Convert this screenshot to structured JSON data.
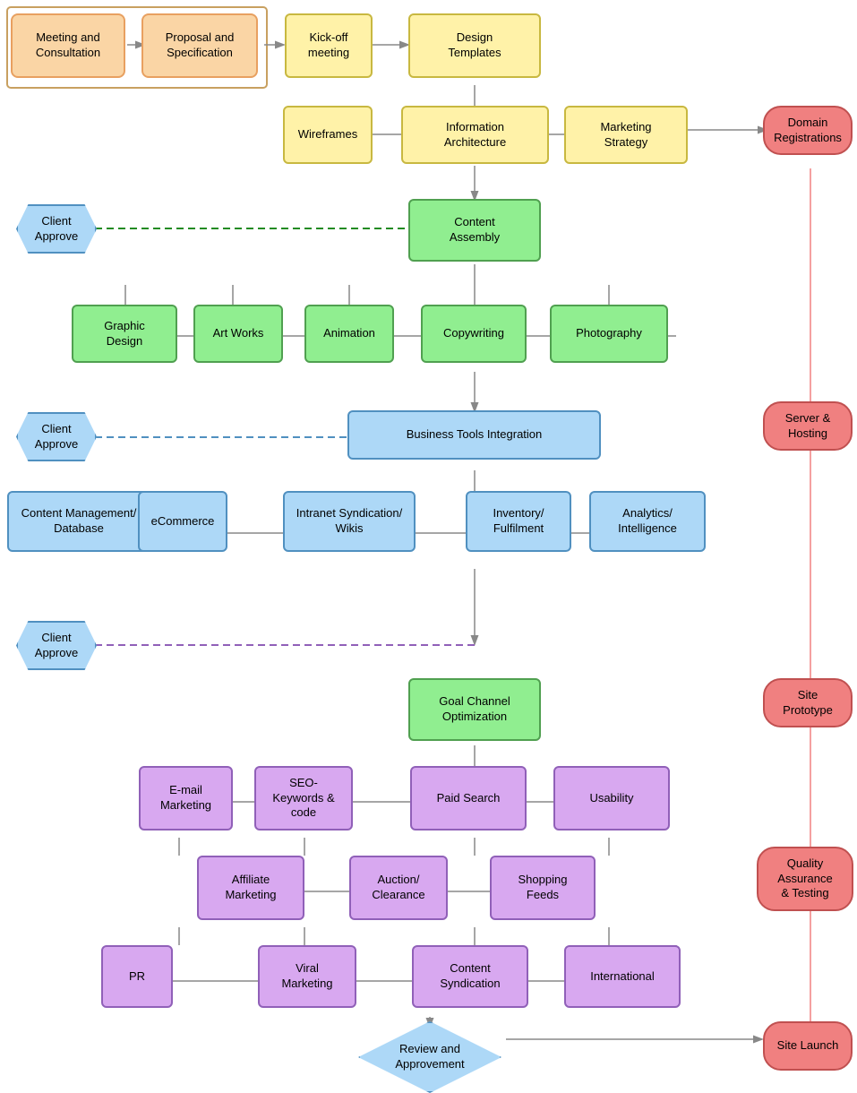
{
  "boxes": {
    "meeting": {
      "label": "Meeting and\nConsultation"
    },
    "proposal": {
      "label": "Proposal and\nSpecification"
    },
    "kickoff": {
      "label": "Kick-off\nmeeting"
    },
    "designTemplates": {
      "label": "Design\nTemplates"
    },
    "wireframes": {
      "label": "Wireframes"
    },
    "infoArch": {
      "label": "Information\nArchitecture"
    },
    "marketingStrategy": {
      "label": "Marketing\nStrategy"
    },
    "domainReg": {
      "label": "Domain\nRegistrations"
    },
    "contentAssembly": {
      "label": "Content\nAssembly"
    },
    "graphicDesign": {
      "label": "Graphic\nDesign"
    },
    "artWorks": {
      "label": "Art Works"
    },
    "animation": {
      "label": "Animation"
    },
    "copywriting": {
      "label": "Copywriting"
    },
    "photography": {
      "label": "Photography"
    },
    "clientApprove1": {
      "label": "Client\nApprove"
    },
    "clientApprove2": {
      "label": "Client\nApprove"
    },
    "clientApprove3": {
      "label": "Client\nApprove"
    },
    "bizTools": {
      "label": "Business Tools Integration"
    },
    "contentMgmt": {
      "label": "Content Management/\nDatabase"
    },
    "ecommerce": {
      "label": "eCommerce"
    },
    "intranet": {
      "label": "Intranet Syndication/\nWikis"
    },
    "inventory": {
      "label": "Inventory/\nFulfilment"
    },
    "analytics": {
      "label": "Analytics/\nIntelligence"
    },
    "serverHosting": {
      "label": "Server & Hosting"
    },
    "goalChannel": {
      "label": "Goal Channel\nOptimization"
    },
    "sitePrototype": {
      "label": "Site Prototype"
    },
    "emailMarketing": {
      "label": "E-mail\nMarketing"
    },
    "seoKeywords": {
      "label": "SEO-\nKeywords &\ncode"
    },
    "paidSearch": {
      "label": "Paid Search"
    },
    "usability": {
      "label": "Usability"
    },
    "affiliateMarketing": {
      "label": "Affiliate\nMarketing"
    },
    "auctionClearance": {
      "label": "Auction/\nClearance"
    },
    "shoppingFeeds": {
      "label": "Shopping\nFeeds"
    },
    "pr": {
      "label": "PR"
    },
    "viralMarketing": {
      "label": "Viral\nMarketing"
    },
    "contentSyndication": {
      "label": "Content\nSyndication"
    },
    "international": {
      "label": "International"
    },
    "qualityAssurance": {
      "label": "Quality Assurance\n& Testing"
    },
    "reviewApprovement": {
      "label": "Review and\nApprovement"
    },
    "siteLaunch": {
      "label": "Site Launch"
    }
  }
}
